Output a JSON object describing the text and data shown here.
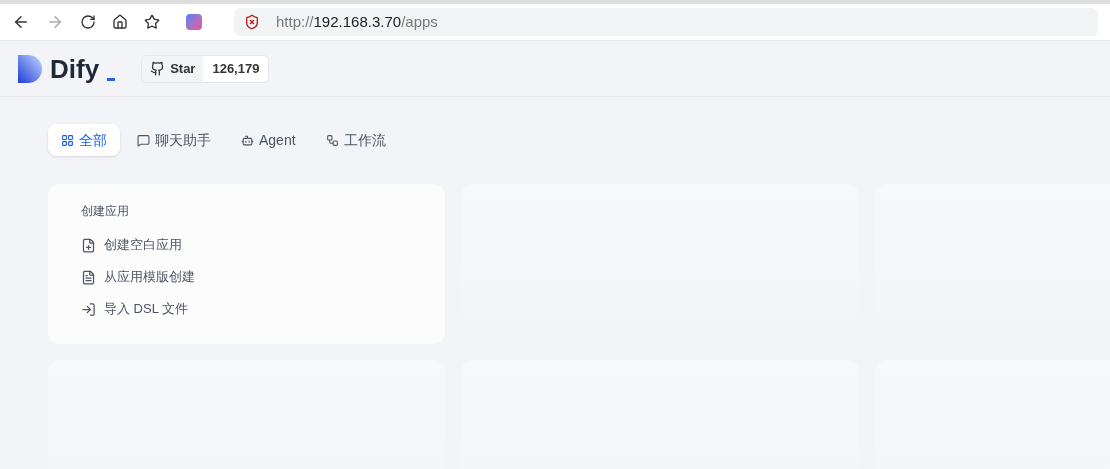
{
  "browser": {
    "url": {
      "scheme": "http://",
      "host": "192.168.3.70",
      "path": "/apps"
    }
  },
  "header": {
    "logo": "Dify",
    "github": {
      "label": "Star",
      "count": "126,179"
    }
  },
  "tabs": [
    {
      "kind": "all",
      "label": "全部",
      "selected": true
    },
    {
      "kind": "chat",
      "label": "聊天助手",
      "selected": false
    },
    {
      "kind": "agent",
      "label": "Agent",
      "selected": false
    },
    {
      "kind": "workflow",
      "label": "工作流",
      "selected": false
    }
  ],
  "create_card": {
    "title": "创建应用",
    "items": [
      {
        "kind": "blank",
        "label": "创建空白应用"
      },
      {
        "kind": "template",
        "label": "从应用模版创建"
      },
      {
        "kind": "import",
        "label": "导入 DSL 文件"
      }
    ]
  }
}
